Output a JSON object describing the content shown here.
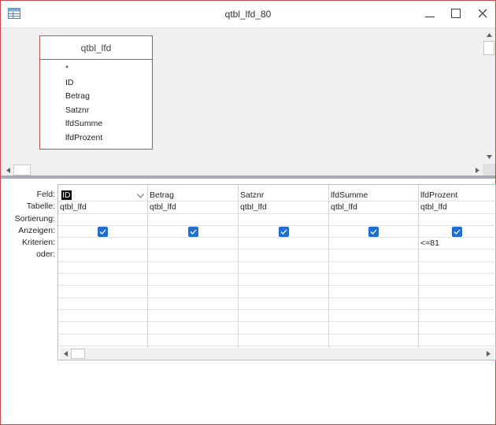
{
  "window": {
    "title": "qtbl_lfd_80",
    "icons": {
      "app": "query-design-icon",
      "minimize": "minimize-icon",
      "maximize": "maximize-icon",
      "close": "close-icon"
    }
  },
  "table_box": {
    "name": "qtbl_lfd",
    "fields": [
      "*",
      "ID",
      "Betrag",
      "Satznr",
      "lfdSumme",
      "lfdProzent"
    ]
  },
  "grid": {
    "row_labels": [
      "Feld:",
      "Tabelle:",
      "Sortierung:",
      "Anzeigen:",
      "Kriterien:",
      "oder:"
    ],
    "columns": [
      {
        "field": "ID",
        "table": "qtbl_lfd",
        "sort": "",
        "show": true,
        "criteria": "",
        "or": ""
      },
      {
        "field": "Betrag",
        "table": "qtbl_lfd",
        "sort": "",
        "show": true,
        "criteria": "",
        "or": ""
      },
      {
        "field": "Satznr",
        "table": "qtbl_lfd",
        "sort": "",
        "show": true,
        "criteria": "",
        "or": ""
      },
      {
        "field": "lfdSumme",
        "table": "qtbl_lfd",
        "sort": "",
        "show": true,
        "criteria": "",
        "or": ""
      },
      {
        "field": "lfdProzent",
        "table": "qtbl_lfd",
        "sort": "",
        "show": true,
        "criteria": "<=81",
        "or": ""
      }
    ]
  },
  "colors": {
    "window_border": "#c8474a",
    "table_border": "#c0504d",
    "checkbox": "#1f6fd1",
    "splitter": "#a9a9b5"
  }
}
